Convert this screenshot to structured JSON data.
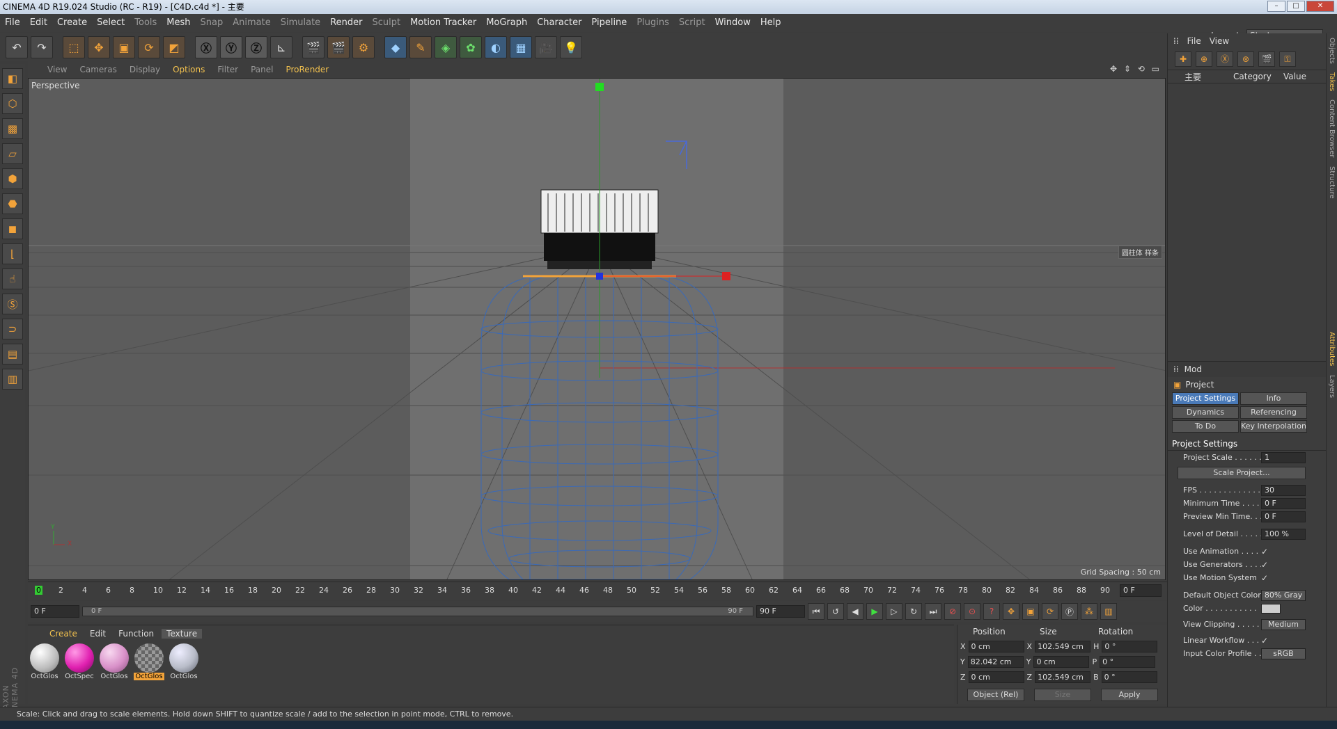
{
  "window": {
    "title": "CINEMA 4D R19.024 Studio (RC - R19) - [C4D.c4d *] - 主要",
    "controls": [
      "–",
      "□",
      "✕"
    ]
  },
  "menu": [
    "File",
    "Edit",
    "Create",
    "Select",
    "Tools",
    "Mesh",
    "Snap",
    "Animate",
    "Simulate",
    "Render",
    "Sculpt",
    "Motion Tracker",
    "MoGraph",
    "Character",
    "Pipeline",
    "Plugins",
    "Script",
    "Window",
    "Help"
  ],
  "layout": {
    "label": "Layout:",
    "value": "Startup"
  },
  "viewport": {
    "menu": [
      "View",
      "Cameras",
      "Display",
      "Options",
      "Filter",
      "Panel",
      "ProRender"
    ],
    "label": "Perspective",
    "grid_spacing": "Grid Spacing : 50 cm",
    "tag": "圆柱体 样条",
    "axis_y": "Y",
    "axis_x": "X"
  },
  "timeline": {
    "ticks": [
      "0",
      "2",
      "4",
      "6",
      "8",
      "10",
      "12",
      "14",
      "16",
      "18",
      "20",
      "22",
      "24",
      "26",
      "28",
      "30",
      "32",
      "34",
      "36",
      "38",
      "40",
      "42",
      "44",
      "46",
      "48",
      "50",
      "52",
      "54",
      "56",
      "58",
      "60",
      "62",
      "64",
      "66",
      "68",
      "70",
      "72",
      "74",
      "76",
      "78",
      "80",
      "82",
      "84",
      "86",
      "88",
      "90"
    ],
    "current_frame": "0 F",
    "start": "0 F",
    "slider_start": "0 F",
    "slider_end": "90 F",
    "end": "90 F"
  },
  "materials": {
    "tabs": [
      "Create",
      "Edit",
      "Function",
      "Texture"
    ],
    "items": [
      {
        "label": "OctGlos",
        "color": "#e6e6e6"
      },
      {
        "label": "OctSpec",
        "color": "#e020b0"
      },
      {
        "label": "OctGlos",
        "color": "#d890c8"
      },
      {
        "label": "OctGlos",
        "color": "#8a8a8a",
        "selected": true
      },
      {
        "label": "OctGlos",
        "color": "#b8bcc8"
      }
    ]
  },
  "coords": {
    "headers": [
      "Position",
      "Size",
      "Rotation"
    ],
    "rows": [
      {
        "axis": "X",
        "pos": "0 cm",
        "size_axis": "X",
        "size": "102.549 cm",
        "rot_axis": "H",
        "rot": "0 °"
      },
      {
        "axis": "Y",
        "pos": "82.042 cm",
        "size_axis": "Y",
        "size": "0 cm",
        "rot_axis": "P",
        "rot": "0 °"
      },
      {
        "axis": "Z",
        "pos": "0 cm",
        "size_axis": "Z",
        "size": "102.549 cm",
        "rot_axis": "B",
        "rot": "0 °"
      }
    ],
    "mode": "Object (Rel)",
    "size_mode": "Size",
    "apply": "Apply"
  },
  "status": "Scale: Click and drag to scale elements. Hold down SHIFT to quantize scale / add to the selection in point mode, CTRL to remove.",
  "objects": {
    "menu": [
      "File",
      "View"
    ],
    "col_name": "主要",
    "col_category": "Category",
    "col_value": "Value"
  },
  "attributes": {
    "mode": "Mod",
    "project": "Project",
    "tabs": [
      "Project Settings",
      "Info",
      "Dynamics",
      "Referencing",
      "To Do",
      "Key Interpolation"
    ],
    "section": "Project Settings",
    "scale_button": "Scale Project...",
    "rows": [
      {
        "label": "Project Scale . . . . . .",
        "value": "1"
      },
      {
        "label": "FPS . . . . . . . . . . . . . .",
        "value": "30"
      },
      {
        "label": "Minimum Time . . . . .",
        "value": "0 F"
      },
      {
        "label": "Preview Min Time. . .",
        "value": "0 F"
      },
      {
        "label": "Level of Detail . . . . .",
        "value": "100 %"
      },
      {
        "label": "Use Animation . . . . .",
        "value": "✓"
      },
      {
        "label": "Use Generators . . . .",
        "value": "✓"
      },
      {
        "label": "Use Motion System",
        "value": "✓"
      },
      {
        "label": "Default Object Color",
        "value": "80% Gray"
      },
      {
        "label": "Color . . . . . . . . . . .",
        "value": ""
      },
      {
        "label": "View Clipping . . . . .",
        "value": "Medium"
      },
      {
        "label": "Linear Workflow . . .",
        "value": "✓"
      },
      {
        "label": "Input Color Profile . .",
        "value": "sRGB"
      }
    ]
  },
  "sidetabs": [
    "Objects",
    "Takes",
    "Content Browser",
    "Structure",
    "Attributes",
    "Layers"
  ]
}
